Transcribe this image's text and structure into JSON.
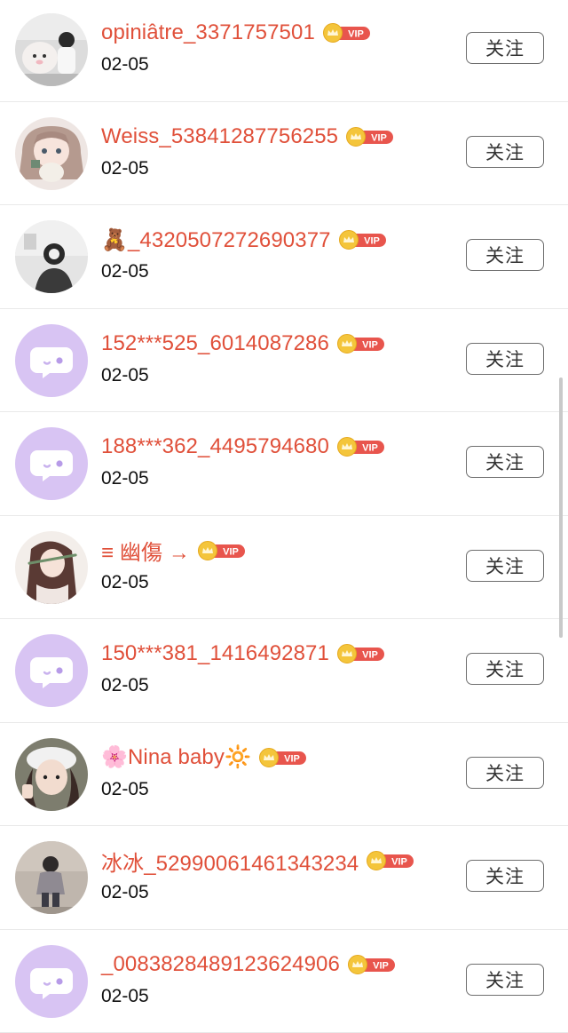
{
  "follow_label": "关注",
  "users": [
    {
      "name": "opiniâtre_3371757501",
      "date": "02-05",
      "avatar": "photo-plush-toys",
      "vip": true
    },
    {
      "name": "Weiss_53841287756255",
      "date": "02-05",
      "avatar": "anime-girl-with-cat",
      "vip": true
    },
    {
      "name": "🧸_4320507272690377",
      "date": "02-05",
      "avatar": "photo-girl-headphones",
      "vip": true
    },
    {
      "name": "152***525_6014087286",
      "date": "02-05",
      "avatar": "default-chat-bubble",
      "vip": true
    },
    {
      "name": "188***362_4495794680",
      "date": "02-05",
      "avatar": "default-chat-bubble",
      "vip": true
    },
    {
      "name": "≡ 幽傷 →",
      "date": "02-05",
      "avatar": "illustration-girl-flute",
      "vip": true
    },
    {
      "name": "150***381_1416492871",
      "date": "02-05",
      "avatar": "default-chat-bubble",
      "vip": true
    },
    {
      "name": "🌸Nina baby🔆",
      "date": "02-05",
      "avatar": "photo-girl-fur-hat",
      "vip": true
    },
    {
      "name": "冰冰_52990061461343234",
      "date": "02-05",
      "avatar": "photo-child-street",
      "vip": true
    },
    {
      "name": "_0083828489123624906",
      "date": "02-05",
      "avatar": "default-chat-bubble",
      "vip": true
    }
  ],
  "vip_badge": {
    "text": "VIP",
    "icon": "crown-icon",
    "coin_color": "#f4c53b",
    "tag_color": "#e8554d"
  },
  "colors": {
    "username": "#e0503a",
    "default_avatar_bg": "#d8c4f3",
    "date": "#111111"
  }
}
